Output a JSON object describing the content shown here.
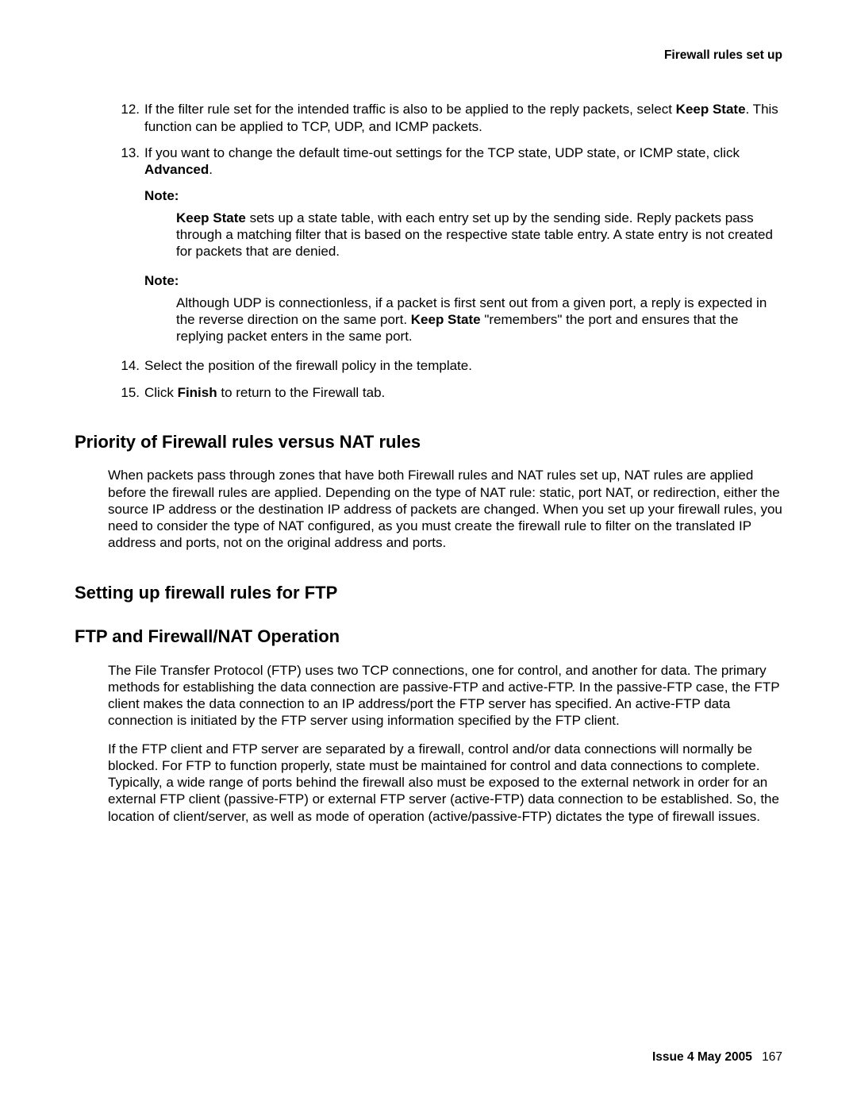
{
  "header": {
    "title": "Firewall rules set up"
  },
  "step12": {
    "num": "12.",
    "pre": "If the filter rule set for the intended traffic is also to be applied to the reply packets, select ",
    "bold": "Keep State",
    "post": ". This function can be applied to TCP, UDP, and ICMP packets."
  },
  "step13": {
    "num": "13.",
    "pre": "If you want to change the default time-out settings for the TCP state, UDP state, or ICMP state, click ",
    "bold": "Advanced",
    "post": "."
  },
  "note1": {
    "label": "Note:",
    "bold": "Keep State",
    "rest": " sets up a state table, with each entry set up by the sending side. Reply packets pass through a matching filter that is based on the respective state table entry. A state entry is not created for packets that are denied."
  },
  "note2": {
    "label": "Note:",
    "pre": "Although UDP is connectionless, if a packet is first sent out from a given port, a reply is expected in the reverse direction on the same port. ",
    "bold": "Keep State",
    "post": " \"remembers\" the port and ensures that the replying packet enters in the same port."
  },
  "step14": {
    "num": "14.",
    "text": "Select the position of the firewall policy in the template."
  },
  "step15": {
    "num": "15.",
    "pre": "Click ",
    "bold": "Finish",
    "post": " to return to the Firewall tab."
  },
  "sec1": {
    "heading": "Priority of Firewall rules versus NAT rules",
    "body": "When packets pass through zones that have both Firewall rules and NAT rules set up, NAT rules are applied before the firewall rules are applied. Depending on the type of NAT rule: static, port NAT, or redirection, either the source IP address or the destination IP address of packets are changed. When you set up your firewall rules, you need to consider the type of NAT configured, as you must create the firewall rule to filter on the translated IP address and ports, not on the original address and ports."
  },
  "sec2": {
    "heading": "Setting up firewall rules for FTP"
  },
  "sec3": {
    "heading": "FTP and Firewall/NAT Operation",
    "p1": "The File Transfer Protocol (FTP) uses two TCP connections, one for control, and another for data. The primary methods for establishing the data connection are passive-FTP and active-FTP. In the passive-FTP case, the FTP client makes the data connection to an IP address/port the FTP server has specified. An active-FTP data connection is initiated by the FTP server using information specified by the FTP client.",
    "p2": "If the FTP client and FTP server are separated by a firewall, control and/or data connections will normally be blocked. For FTP to function properly, state must be maintained for control and data connections to complete. Typically, a wide range of ports behind the firewall also must be exposed to the external network in order for an external FTP client (passive-FTP) or external FTP server (active-FTP) data connection to be established. So, the location of client/server, as well as mode of operation (active/passive-FTP) dictates the type of firewall issues."
  },
  "footer": {
    "issue": "Issue 4   May 2005",
    "page": "167"
  }
}
